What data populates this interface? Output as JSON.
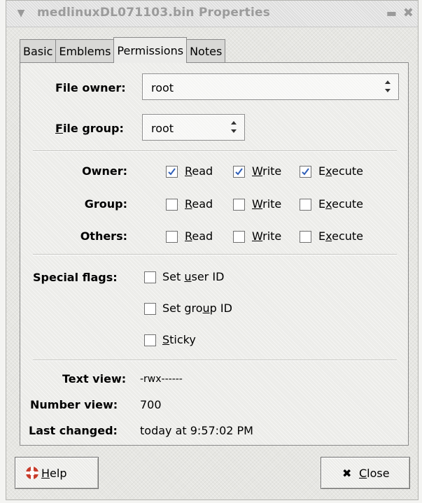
{
  "window": {
    "title": "medlinuxDL071103.bin Properties",
    "menu_icon": "chevron-down-icon",
    "minimize_icon": "minimize-icon",
    "close_icon": "close-icon"
  },
  "tabs": [
    {
      "label": "Basic",
      "active": false
    },
    {
      "label": "Emblems",
      "active": false
    },
    {
      "label": "Permissions",
      "active": true
    },
    {
      "label": "Notes",
      "active": false
    }
  ],
  "owner": {
    "label_prefix": "File owner:",
    "value": "root"
  },
  "group": {
    "label_mnemonic": "F",
    "label_rest": "ile group:",
    "value": "root"
  },
  "permissions": {
    "rows": [
      {
        "label": "Owner:",
        "read": true,
        "write": true,
        "execute": true
      },
      {
        "label": "Group:",
        "read": false,
        "write": false,
        "execute": false
      },
      {
        "label": "Others:",
        "read": false,
        "write": false,
        "execute": false
      }
    ],
    "read_mn": "R",
    "read_rest": "ead",
    "write_mn": "W",
    "write_rest": "rite",
    "exec_pre": "E",
    "exec_mn": "x",
    "exec_rest": "ecute"
  },
  "special": {
    "label": "Special flags:",
    "setuid_pre": "Set ",
    "setuid_mn": "u",
    "setuid_rest": "ser ID",
    "setgid_pre": "Set gro",
    "setgid_mn": "u",
    "setgid_rest": "p ID",
    "sticky_mn": "S",
    "sticky_rest": "ticky",
    "setuid_checked": false,
    "setgid_checked": false,
    "sticky_checked": false
  },
  "info": {
    "text_view_label": "Text view:",
    "text_view_value": "-rwx------",
    "number_view_label": "Number view:",
    "number_view_value": "700",
    "last_changed_label": "Last changed:",
    "last_changed_value": "today at 9:57:02 PM"
  },
  "buttons": {
    "help_mn": "H",
    "help_rest": "elp",
    "help_icon": "lifebuoy-icon",
    "close_mn": "C",
    "close_rest": "lose",
    "close_icon": "close-x-icon"
  },
  "colors": {
    "check": "#2f5fb8",
    "help_icon": "#c83b2a"
  }
}
